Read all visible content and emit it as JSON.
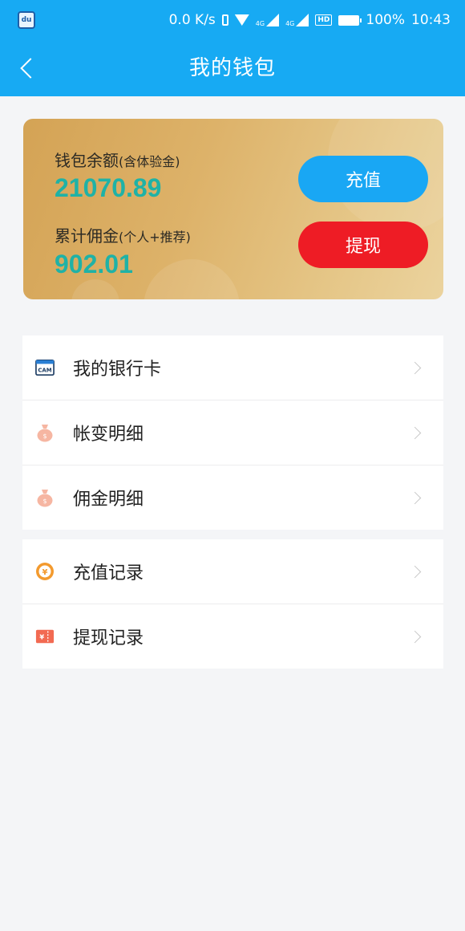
{
  "status_bar": {
    "app_icon": "app-icon",
    "net_speed": "0.0 K/s",
    "net_small_1": "4G",
    "net_small_2": "4G",
    "hd": "HD",
    "battery": "100%",
    "time": "10:43"
  },
  "header": {
    "title": "我的钱包",
    "back_icon": "chevron-left-icon"
  },
  "wallet": {
    "balance_label": "钱包余额",
    "balance_note": "(含体验金)",
    "balance_value": "21070.89",
    "commission_label": "累计佣金",
    "commission_note": "(个人+推荐)",
    "commission_value": "902.01",
    "recharge_button": "充值",
    "withdraw_button": "提现"
  },
  "menu": {
    "group1": [
      {
        "label": "我的银行卡",
        "icon": "bank-card-icon",
        "icon_text": "CAM"
      },
      {
        "label": "帐变明细",
        "icon": "money-bag-icon"
      },
      {
        "label": "佣金明细",
        "icon": "money-bag-icon"
      }
    ],
    "group2": [
      {
        "label": "充值记录",
        "icon": "coin-icon",
        "icon_text": "¥"
      },
      {
        "label": "提现记录",
        "icon": "ticket-icon",
        "icon_text": "¥"
      }
    ]
  },
  "colors": {
    "header_bg": "#17aaf3",
    "balance_value": "#1fb2a6",
    "recharge_btn": "#19a7f4",
    "withdraw_btn": "#ee1c25"
  }
}
